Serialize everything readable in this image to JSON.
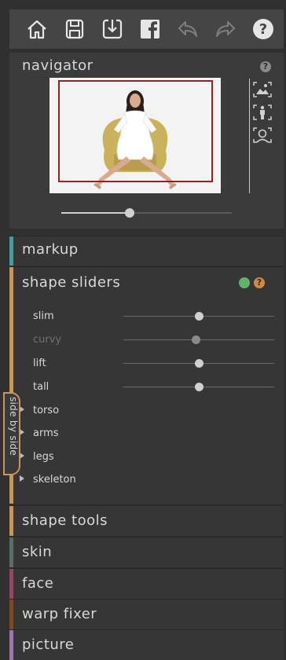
{
  "toolbar": {
    "items": [
      {
        "icon": "home-icon"
      },
      {
        "icon": "save-icon"
      },
      {
        "icon": "export-icon"
      },
      {
        "icon": "facebook-icon"
      },
      {
        "icon": "undo-icon"
      },
      {
        "icon": "redo-icon"
      },
      {
        "icon": "help-icon"
      }
    ]
  },
  "navigator": {
    "title": "navigator",
    "help_symbol": "?",
    "zoom_level": 0.4,
    "side_icons": [
      "fit-image-icon",
      "full-body-icon",
      "face-icon"
    ]
  },
  "sections": {
    "markup": {
      "title": "markup",
      "color": "#4f9a98"
    },
    "shape_sliders": {
      "title": "shape sliders",
      "color": "#c8965a",
      "status_color": "#5fb36a",
      "help_symbol": "?",
      "sliders": [
        {
          "label": "slim",
          "value": 0.5,
          "enabled": true
        },
        {
          "label": "curvy",
          "value": 0.48,
          "enabled": false
        },
        {
          "label": "lift",
          "value": 0.5,
          "enabled": true
        },
        {
          "label": "tall",
          "value": 0.5,
          "enabled": true
        }
      ],
      "groups": [
        {
          "label": "torso"
        },
        {
          "label": "arms"
        },
        {
          "label": "legs"
        },
        {
          "label": "skeleton"
        }
      ]
    },
    "shape_tools": {
      "title": "shape tools",
      "color": "#c8965a"
    },
    "skin": {
      "title": "skin",
      "color": "#5a6e66"
    },
    "face": {
      "title": "face",
      "color": "#8c4a66"
    },
    "warp_fixer": {
      "title": "warp fixer",
      "color": "#7a4a22"
    },
    "picture": {
      "title": "picture",
      "color": "#9a7aa8"
    }
  },
  "side_tab": {
    "label": "side by side"
  }
}
